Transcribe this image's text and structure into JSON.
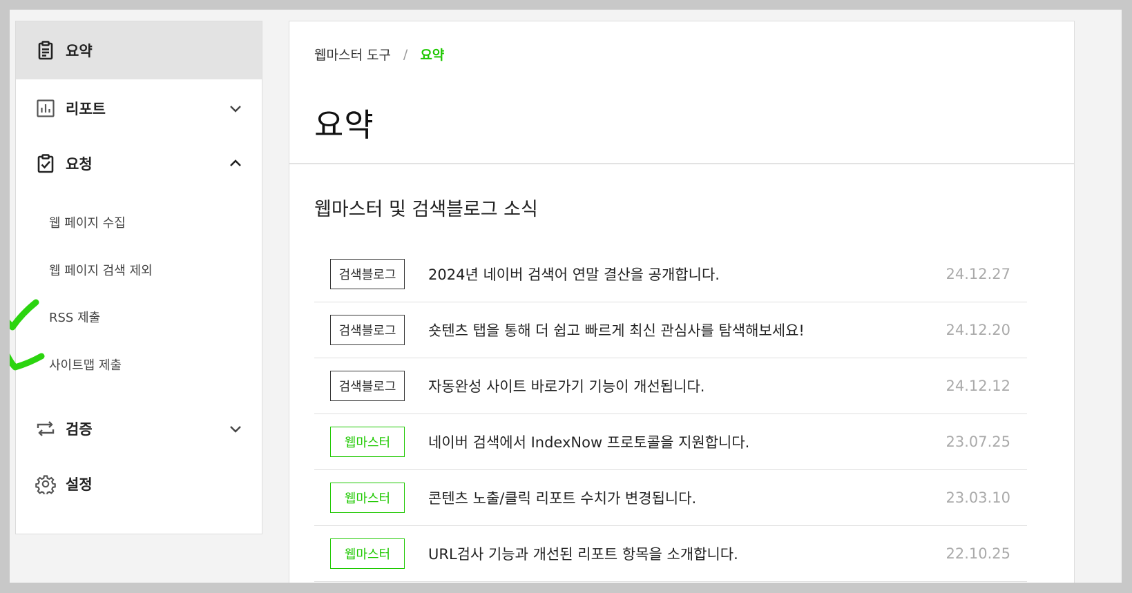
{
  "sidebar": {
    "items": [
      {
        "label": "요약",
        "icon": "clipboard-icon"
      },
      {
        "label": "리포트",
        "icon": "bar-chart-icon"
      },
      {
        "label": "요청",
        "icon": "clipboard-check-icon"
      },
      {
        "label": "검증",
        "icon": "repeat-icon"
      },
      {
        "label": "설정",
        "icon": "gear-icon"
      }
    ],
    "sub_items": [
      "웹 페이지 수집",
      "웹 페이지 검색 제외",
      "RSS 제출",
      "사이트맵 제출"
    ]
  },
  "breadcrumb": {
    "parent": "웹마스터 도구",
    "separator": "/",
    "current": "요약"
  },
  "page_title": "요약",
  "section_title": "웹마스터 및 검색블로그 소식",
  "news": [
    {
      "tag": "검색블로그",
      "title": "2024년 네이버 검색어 연말 결산을 공개합니다.",
      "date": "24.12.27"
    },
    {
      "tag": "검색블로그",
      "title": "숏텐츠 탭을 통해 더 쉽고 빠르게 최신 관심사를 탐색해보세요!",
      "date": "24.12.20"
    },
    {
      "tag": "검색블로그",
      "title": "자동완성 사이트 바로가기 기능이 개선됩니다.",
      "date": "24.12.12"
    },
    {
      "tag": "웹마스터",
      "title": "네이버 검색에서 IndexNow 프로토콜을 지원합니다.",
      "date": "23.07.25"
    },
    {
      "tag": "웹마스터",
      "title": "콘텐츠 노출/클릭 리포트 수치가 변경됩니다.",
      "date": "23.03.10"
    },
    {
      "tag": "웹마스터",
      "title": "URL검사 기능과 개선된 리포트 항목을 소개합니다.",
      "date": "22.10.25"
    }
  ],
  "colors": {
    "accent": "#1ec800",
    "check_marks": "#2bd40f",
    "active_bg": "#e3e3e3"
  }
}
